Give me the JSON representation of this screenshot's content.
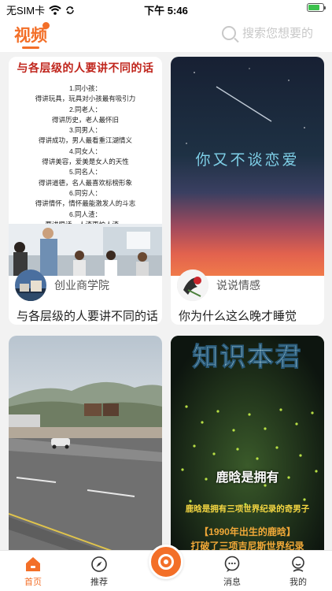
{
  "status_bar": {
    "carrier": "无SIM卡",
    "time": "下午 5:46",
    "battery_level": 0.75
  },
  "header": {
    "title": "视频",
    "search_placeholder": "搜索您想要的"
  },
  "feed": {
    "cards": [
      {
        "author": "创业商学院",
        "caption": "与各层级的人要讲不同的话",
        "thumbnail_title": "与各层级的人要讲不同的话",
        "thumbnail_lines": [
          "1.同小孩：",
          "得讲玩具，玩具对小孩最有吸引力",
          "2.同老人：",
          "得讲历史，老人最怀旧",
          "3.同男人：",
          "得讲成功，男人最看重江湖情义",
          "4.同女人：",
          "得讲美容，爱美是女人的天性",
          "5.同名人：",
          "得讲道德，名人最喜欢标榜形象",
          "6.同穷人：",
          "得讲情怀，情怀最能激发人的斗志",
          "6.同人渣：",
          "要讲狠话，人渣更怕人渣。"
        ]
      },
      {
        "author": "说说情感",
        "caption": "你为什么这么晚才睡觉",
        "thumbnail_text": "你又不谈恋爱"
      },
      {
        "author": "",
        "caption": ""
      },
      {
        "author": "",
        "caption": "",
        "thumbnail_title": "知识本君",
        "thumbnail_subtitle": "鹿晗是拥有",
        "thumbnail_line1": "鹿晗是拥有三项世界纪录的奇男子",
        "thumbnail_line2": "【1990年出生的鹿晗】",
        "thumbnail_line3": "打破了三项吉尼斯世界纪录"
      }
    ]
  },
  "tabbar": {
    "items": [
      {
        "label": "首页",
        "icon": "home-icon"
      },
      {
        "label": "推荐",
        "icon": "compass-icon"
      },
      {
        "label": "",
        "icon": "center-record-icon"
      },
      {
        "label": "消息",
        "icon": "message-icon"
      },
      {
        "label": "我的",
        "icon": "profile-icon"
      }
    ]
  },
  "colors": {
    "accent": "#f36f28",
    "title_red": "#c0261d",
    "battery_green": "#3cc14d"
  }
}
